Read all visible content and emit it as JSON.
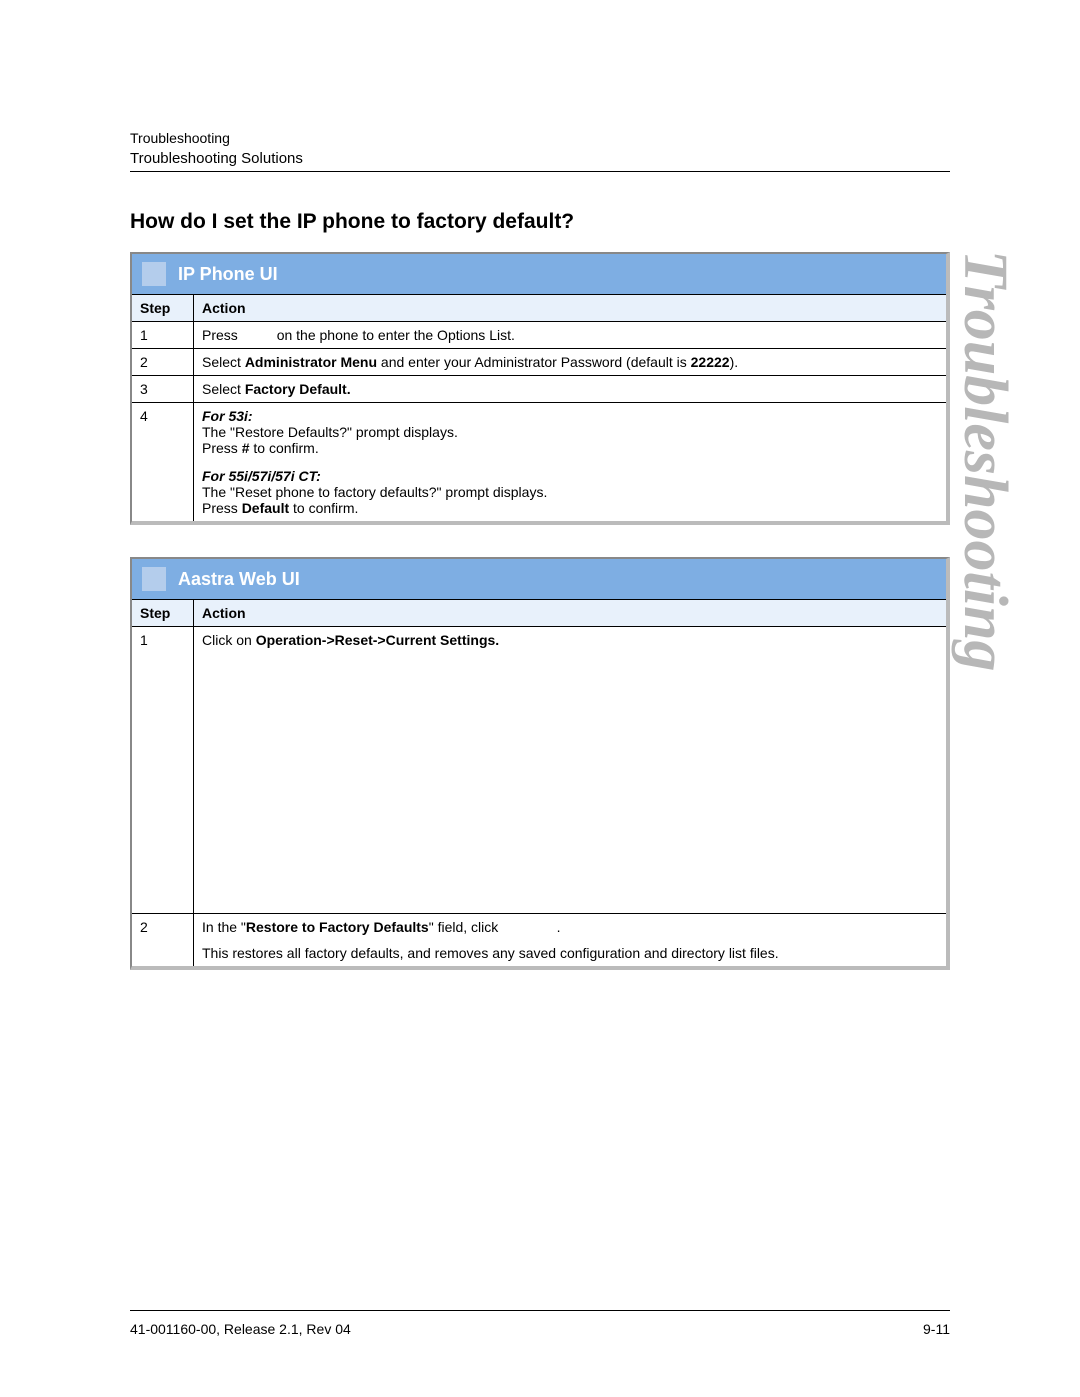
{
  "watermark": "Troubleshooting",
  "header": {
    "top": "Troubleshooting",
    "sub": "Troubleshooting Solutions"
  },
  "heading": "How do I set the IP phone to factory default?",
  "box1": {
    "title": "IP Phone UI",
    "col_step": "Step",
    "col_action": "Action",
    "rows": {
      "r1": {
        "step": "1",
        "t1": "Press ",
        "t2": " on the phone to enter the Options List."
      },
      "r2": {
        "step": "2",
        "t1": "Select ",
        "b1": "Administrator Menu",
        "t2": " and enter your Administrator Password (default is ",
        "b2": "22222",
        "t3": ")."
      },
      "r3": {
        "step": "3",
        "t1": "Select ",
        "b1": "Factory Default."
      },
      "r4": {
        "step": "4",
        "h53": "For 53i:",
        "l1": "The \"Restore Defaults?\" prompt displays.",
        "l2a": "Press ",
        "l2b": "#",
        "l2c": " to confirm.",
        "h55": "For 55i/57i/57i CT:",
        "l3": "The \"Reset phone to factory defaults?\" prompt displays.",
        "l4a": "Press ",
        "l4b": "Default",
        "l4c": " to confirm."
      }
    }
  },
  "box2": {
    "title": "Aastra Web UI",
    "col_step": "Step",
    "col_action": "Action",
    "rows": {
      "r1": {
        "step": "1",
        "t1": "Click on ",
        "b1": "Operation->Reset->Current Settings."
      },
      "r2": {
        "step": "2",
        "l1a": "In the \"",
        "l1b": "Restore to Factory Defaults",
        "l1c": "\" field, click ",
        "l1d": ".",
        "l2": "This restores all factory defaults, and removes any saved configuration and directory list files."
      }
    }
  },
  "footer": {
    "left": "41-001160-00, Release 2.1, Rev 04",
    "right": "9-11"
  }
}
